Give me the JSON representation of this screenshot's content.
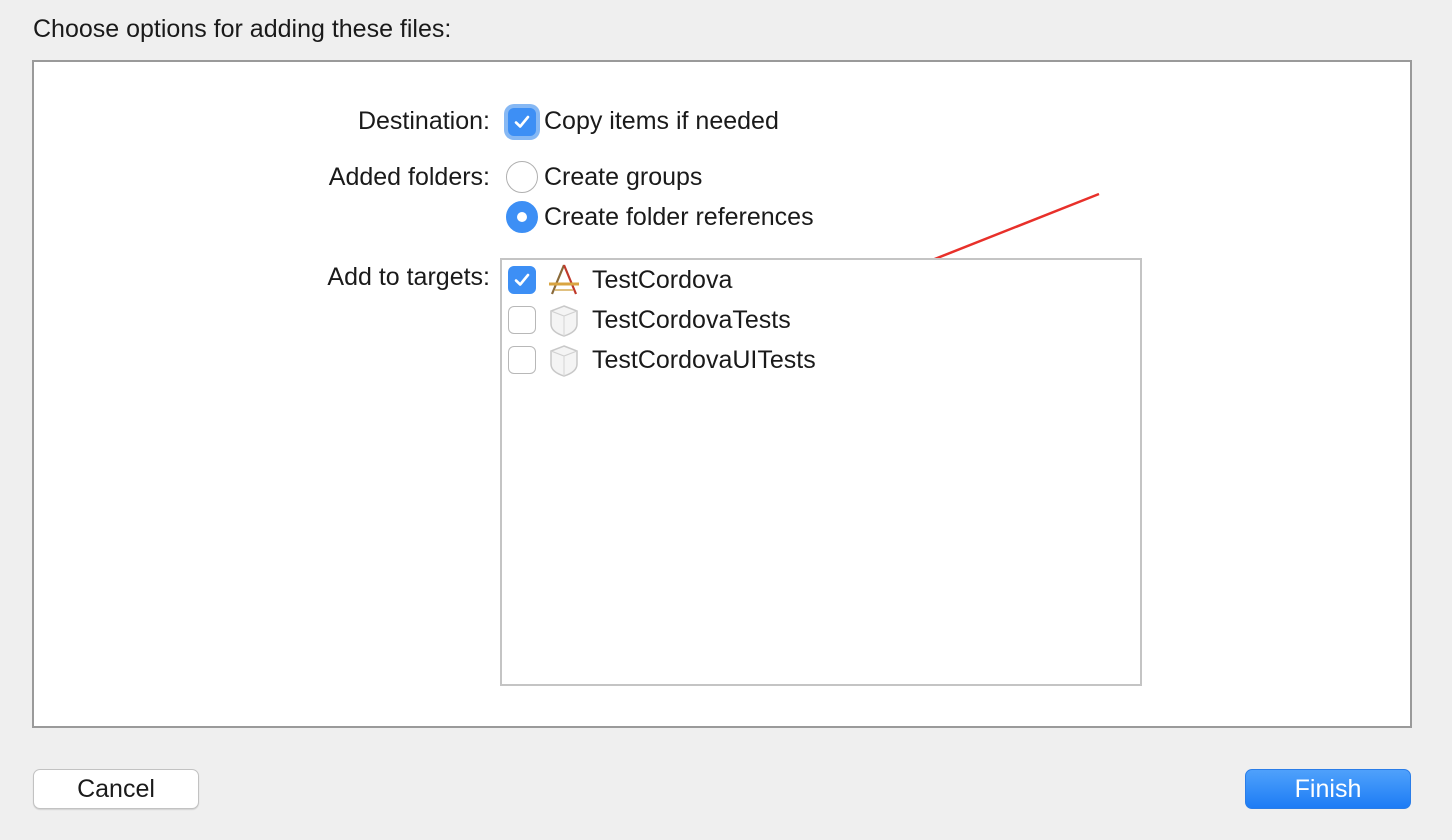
{
  "dialog": {
    "title": "Choose options for adding these files:"
  },
  "destination": {
    "label": "Destination:",
    "copy_items": {
      "text": "Copy items if needed",
      "checked": true
    }
  },
  "added_folders": {
    "label": "Added folders:",
    "options": [
      {
        "text": "Create groups",
        "selected": false
      },
      {
        "text": "Create folder references",
        "selected": true
      }
    ]
  },
  "targets": {
    "label": "Add to targets:",
    "items": [
      {
        "name": "TestCordova",
        "checked": true,
        "icon": "app-target-icon"
      },
      {
        "name": "TestCordovaTests",
        "checked": false,
        "icon": "test-bundle-icon"
      },
      {
        "name": "TestCordovaUITests",
        "checked": false,
        "icon": "test-bundle-icon"
      }
    ]
  },
  "buttons": {
    "cancel": "Cancel",
    "finish": "Finish"
  },
  "colors": {
    "accent": "#3d8ff5",
    "annotation": "#e8302a"
  }
}
